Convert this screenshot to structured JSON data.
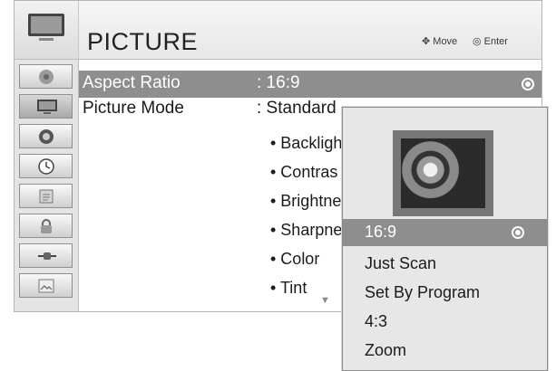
{
  "header": {
    "title": "PICTURE",
    "hints": [
      {
        "icon": "dpad-icon",
        "label": "Move"
      },
      {
        "icon": "ok-button-icon",
        "label": "Enter"
      }
    ]
  },
  "sidebar": [
    {
      "icon": "satellite-dish-icon",
      "active": false
    },
    {
      "icon": "tv-picture-icon",
      "active": true
    },
    {
      "icon": "speaker-audio-icon",
      "active": false
    },
    {
      "icon": "clock-time-icon",
      "active": false
    },
    {
      "icon": "option-list-icon",
      "active": false
    },
    {
      "icon": "lock-icon",
      "active": false
    },
    {
      "icon": "input-plug-icon",
      "active": false
    },
    {
      "icon": "usb-photo-icon",
      "active": false
    }
  ],
  "menu": {
    "aspect_ratio": {
      "label": "Aspect Ratio",
      "value": ": 16:9"
    },
    "picture_mode": {
      "label": "Picture Mode",
      "value": ": Standard"
    },
    "sub_items": [
      "• Backligh",
      "• Contras",
      "• Brightne",
      "• Sharpne",
      "• Color",
      "• Tint"
    ]
  },
  "popup": {
    "options": [
      "16:9",
      "Just Scan",
      "Set By Program",
      "4:3",
      "Zoom"
    ],
    "selected": "16:9"
  },
  "colors": {
    "highlight": "#8e8e8e",
    "background": "#ffffff",
    "sidebar": "#e4e4e4"
  }
}
